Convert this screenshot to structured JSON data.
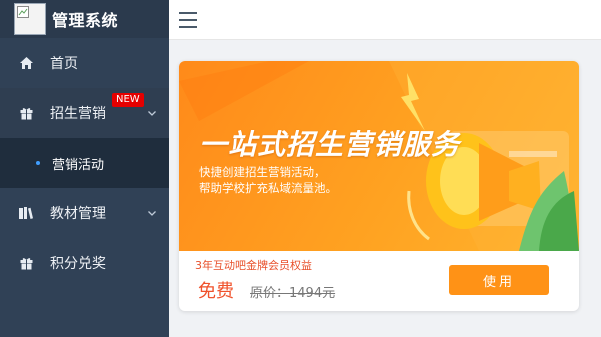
{
  "app": {
    "title": "管理系统",
    "logo_alt": "logo"
  },
  "sidebar": {
    "items": [
      {
        "label": "首页",
        "icon": "home-icon"
      },
      {
        "label": "招生营销",
        "icon": "gift-icon",
        "badge": "NEW",
        "expanded": true,
        "children": [
          {
            "label": "营销活动",
            "active": true
          }
        ]
      },
      {
        "label": "教材管理",
        "icon": "book-icon",
        "expanded": false
      },
      {
        "label": "积分兑奖",
        "icon": "gift-icon"
      }
    ]
  },
  "header": {
    "menu_icon": "hamburger-icon"
  },
  "card": {
    "banner_title": "一站式招生营销服务",
    "banner_line1": "快捷创建招生营销活动，",
    "banner_line2": "帮助学校扩充私域流量池。",
    "benefit": "3年互动吧金牌会员权益",
    "price": "免费",
    "original_price": "原价：1494元",
    "button": "使用"
  },
  "colors": {
    "sidebar_bg": "#304156",
    "accent": "#ff9216",
    "badge": "#e60000",
    "price": "#f0522c"
  }
}
